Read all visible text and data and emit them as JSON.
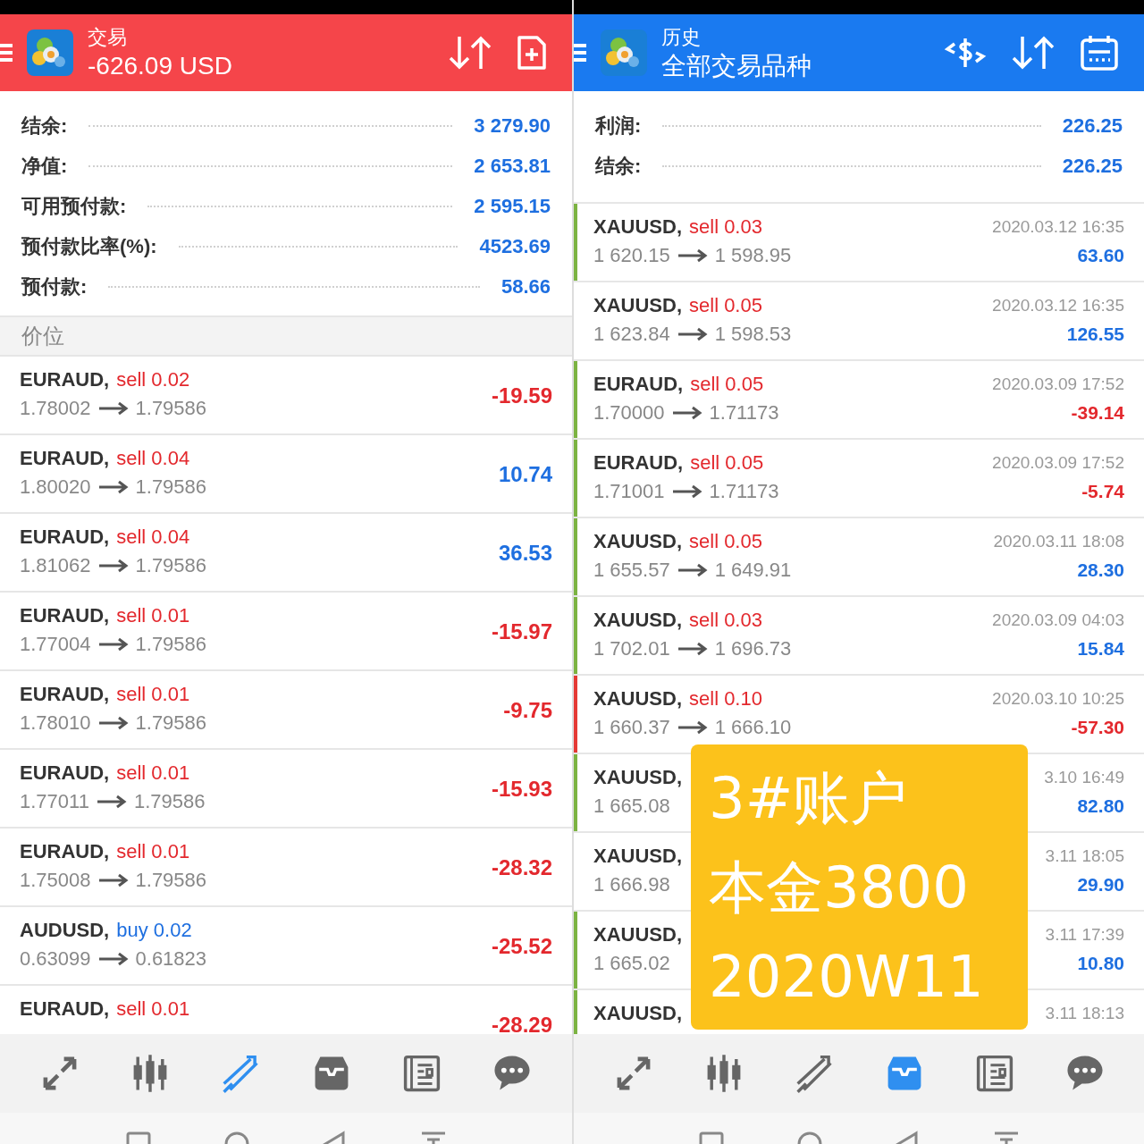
{
  "trade": {
    "title": "交易",
    "subtitle": "-626.09 USD",
    "summary": [
      {
        "label": "结余:",
        "value": "3 279.90"
      },
      {
        "label": "净值:",
        "value": "2 653.81"
      },
      {
        "label": "可用预付款:",
        "value": "2 595.15"
      },
      {
        "label": "预付款比率(%):",
        "value": "4523.69"
      },
      {
        "label": "预付款:",
        "value": "58.66"
      }
    ],
    "section": "价位",
    "positions": [
      {
        "symbol": "EURAUD,",
        "kind": "sell",
        "side": "sell 0.02",
        "open": "1.78002",
        "close": "1.79586",
        "profit": "-19.59",
        "loss": true
      },
      {
        "symbol": "EURAUD,",
        "kind": "sell",
        "side": "sell 0.04",
        "open": "1.80020",
        "close": "1.79586",
        "profit": "10.74",
        "loss": false
      },
      {
        "symbol": "EURAUD,",
        "kind": "sell",
        "side": "sell 0.04",
        "open": "1.81062",
        "close": "1.79586",
        "profit": "36.53",
        "loss": false
      },
      {
        "symbol": "EURAUD,",
        "kind": "sell",
        "side": "sell 0.01",
        "open": "1.77004",
        "close": "1.79586",
        "profit": "-15.97",
        "loss": true
      },
      {
        "symbol": "EURAUD,",
        "kind": "sell",
        "side": "sell 0.01",
        "open": "1.78010",
        "close": "1.79586",
        "profit": "-9.75",
        "loss": true
      },
      {
        "symbol": "EURAUD,",
        "kind": "sell",
        "side": "sell 0.01",
        "open": "1.77011",
        "close": "1.79586",
        "profit": "-15.93",
        "loss": true
      },
      {
        "symbol": "EURAUD,",
        "kind": "sell",
        "side": "sell 0.01",
        "open": "1.75008",
        "close": "1.79586",
        "profit": "-28.32",
        "loss": true
      },
      {
        "symbol": "AUDUSD,",
        "kind": "buy",
        "side": "buy 0.02",
        "open": "0.63099",
        "close": "0.61823",
        "profit": "-25.52",
        "loss": true
      },
      {
        "symbol": "EURAUD,",
        "kind": "sell",
        "side": "sell 0.01",
        "profit": "-28.29",
        "loss": true
      }
    ],
    "nav": [
      {
        "selected": false
      },
      {
        "selected": false
      },
      {
        "selected": true
      },
      {
        "selected": false
      },
      {
        "selected": false
      },
      {
        "selected": false
      }
    ]
  },
  "history": {
    "title": "历史",
    "subtitle": "全部交易品种",
    "summary": [
      {
        "label": "利润:",
        "value": "226.25"
      },
      {
        "label": "结余:",
        "value": "226.25"
      }
    ],
    "deals": [
      {
        "symbol": "XAUUSD,",
        "kind": "sell",
        "side": "sell 0.03",
        "open": "1 620.15",
        "close": "1 598.95",
        "time": "2020.03.12 16:35",
        "profit": "63.60",
        "loss": false,
        "color": "#7cb342"
      },
      {
        "symbol": "XAUUSD,",
        "kind": "sell",
        "side": "sell 0.05",
        "open": "1 623.84",
        "close": "1 598.53",
        "time": "2020.03.12 16:35",
        "profit": "126.55",
        "loss": false
      },
      {
        "symbol": "EURAUD,",
        "kind": "sell",
        "side": "sell 0.05",
        "open": "1.70000",
        "close": "1.71173",
        "time": "2020.03.09 17:52",
        "profit": "-39.14",
        "loss": true,
        "color": "#7cb342"
      },
      {
        "symbol": "EURAUD,",
        "kind": "sell",
        "side": "sell 0.05",
        "open": "1.71001",
        "close": "1.71173",
        "time": "2020.03.09 17:52",
        "profit": "-5.74",
        "loss": true,
        "color": "#7cb342"
      },
      {
        "symbol": "XAUUSD,",
        "kind": "sell",
        "side": "sell 0.05",
        "open": "1 655.57",
        "close": "1 649.91",
        "time": "2020.03.11 18:08",
        "profit": "28.30",
        "loss": false,
        "color": "#7cb342"
      },
      {
        "symbol": "XAUUSD,",
        "kind": "sell",
        "side": "sell 0.03",
        "open": "1 702.01",
        "close": "1 696.73",
        "time": "2020.03.09 04:03",
        "profit": "15.84",
        "loss": false,
        "color": "#7cb342"
      },
      {
        "symbol": "XAUUSD,",
        "kind": "sell",
        "side": "sell 0.10",
        "open": "1 660.37",
        "close": "1 666.10",
        "time": "2020.03.10 10:25",
        "profit": "-57.30",
        "loss": true,
        "color": "#e53935"
      },
      {
        "symbol": "XAUUSD,",
        "open": "1 665.08",
        "time": "3.10 16:49",
        "profit": "82.80",
        "loss": false,
        "color": "#7cb342"
      },
      {
        "symbol": "XAUUSD,",
        "open": "1 666.98",
        "time": "3.11 18:05",
        "profit": "29.90",
        "loss": false
      },
      {
        "symbol": "XAUUSD,",
        "open": "1 665.02",
        "time": "3.11 17:39",
        "profit": "10.80",
        "loss": false,
        "color": "#7cb342"
      },
      {
        "symbol": "XAUUSD,",
        "time": "3.11 18:13",
        "color": "#7cb342"
      }
    ],
    "nav": [
      {
        "selected": false
      },
      {
        "selected": false
      },
      {
        "selected": false
      },
      {
        "selected": true
      },
      {
        "selected": false
      },
      {
        "selected": false
      }
    ]
  },
  "overlay": {
    "lines": [
      "3#账户",
      "本金3800",
      "2020W11"
    ]
  }
}
